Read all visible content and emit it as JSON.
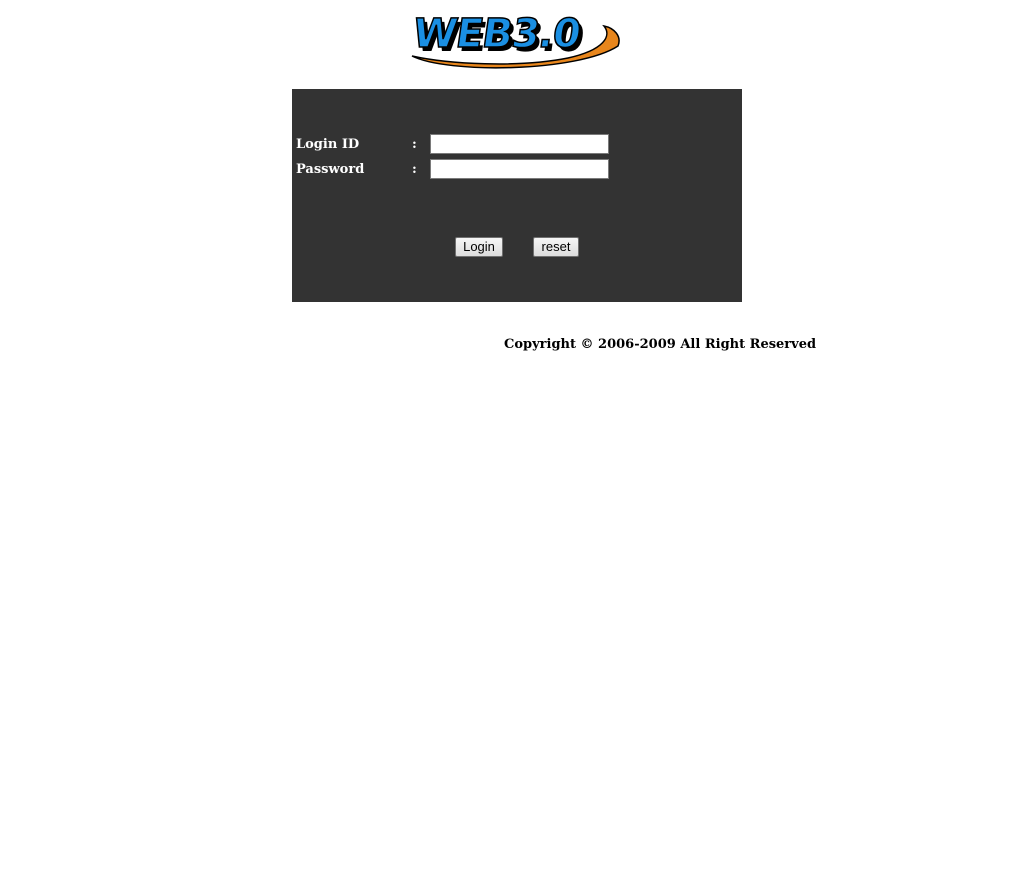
{
  "logo": {
    "text": "WEB3.0",
    "colors": {
      "letters": "#1a8fe3",
      "outline": "#000000",
      "swoosh": "#e8861c"
    }
  },
  "login_form": {
    "background": "#333333",
    "login_id_label": "Login ID",
    "password_label": "Password",
    "colon": ":",
    "login_id_value": "",
    "password_value": "",
    "login_button": "Login",
    "reset_button": "reset"
  },
  "footer": {
    "copyright": "Copyright © 2006-2009 All Right Reserved"
  }
}
